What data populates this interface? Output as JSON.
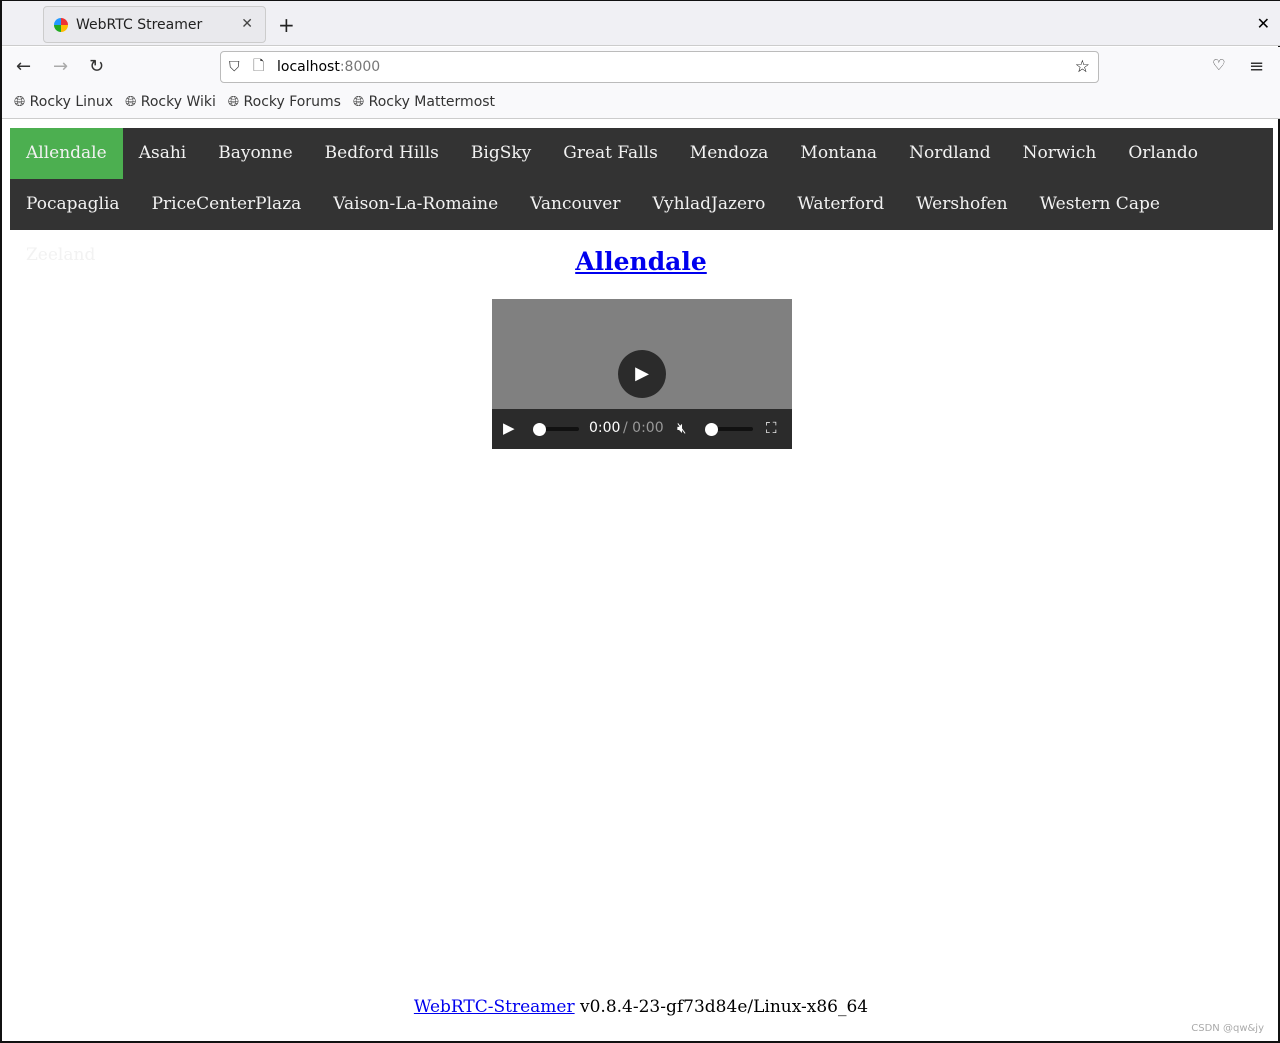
{
  "browser": {
    "tab_title": "WebRTC Streamer",
    "url_host": "localhost",
    "url_port": ":8000",
    "bookmarks": [
      "Rocky Linux",
      "Rocky Wiki",
      "Rocky Forums",
      "Rocky Mattermost"
    ]
  },
  "nav": {
    "items": [
      "Allendale",
      "Asahi",
      "Bayonne",
      "Bedford Hills",
      "BigSky",
      "Great Falls",
      "Mendoza",
      "Montana",
      "Nordland",
      "Norwich",
      "Orlando",
      "Pocapaglia",
      "PriceCenterPlaza",
      "Vaison-La-Romaine",
      "Vancouver",
      "VyhladJazero",
      "Waterford",
      "Wershofen",
      "Western Cape",
      "Zeeland"
    ],
    "active": "Allendale",
    "active_color": "#4CAF50"
  },
  "main": {
    "title": "Allendale"
  },
  "video": {
    "current_time": "0:00",
    "duration": "/ 0:00",
    "muted": true,
    "progress": 0,
    "volume": 0
  },
  "footer": {
    "link": "WebRTC-Streamer",
    "version": "v0.8.4-23-gf73d84e/Linux-x86_64"
  },
  "watermark": "CSDN @qw&jy"
}
